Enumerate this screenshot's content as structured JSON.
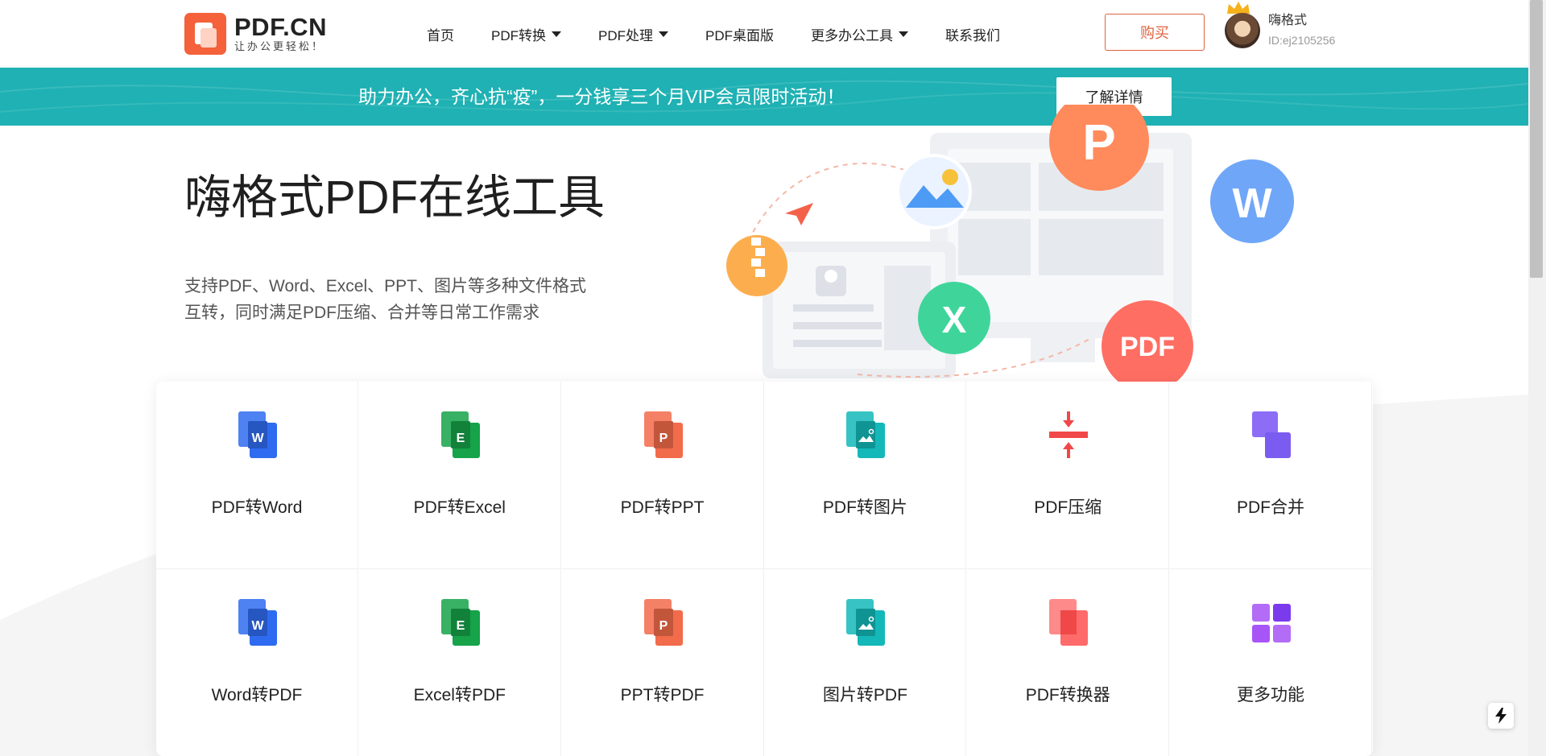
{
  "logo": {
    "title": "PDF.CN",
    "subtitle": "让办公更轻松！"
  },
  "nav": {
    "items": [
      {
        "label": "首页",
        "dropdown": false
      },
      {
        "label": "PDF转换",
        "dropdown": true
      },
      {
        "label": "PDF处理",
        "dropdown": true
      },
      {
        "label": "PDF桌面版",
        "dropdown": false
      },
      {
        "label": "更多办公工具",
        "dropdown": true
      },
      {
        "label": "联系我们",
        "dropdown": false
      }
    ]
  },
  "header": {
    "buy_label": "购买"
  },
  "user": {
    "name": "嗨格式",
    "id": "ID:ej2105256"
  },
  "banner": {
    "text": "助力办公，齐心抗“疫”，一分钱享三个月VIP会员限时活动！",
    "button": "了解详情",
    "color": "#1fb1b3"
  },
  "hero": {
    "title": "嗨格式PDF在线工具",
    "desc_line1": "支持PDF、Word、Excel、PPT、图片等多种文件格式",
    "desc_line2": "互转，同时满足PDF压缩、合并等日常工作需求"
  },
  "illustration": {
    "bubbles": [
      "P",
      "W",
      "X",
      "PDF"
    ]
  },
  "tools": [
    {
      "label": "PDF转Word",
      "icon": "word-doc-icon",
      "color": "#2f6bf0",
      "letter": "W"
    },
    {
      "label": "PDF转Excel",
      "icon": "excel-doc-icon",
      "color": "#16a34a",
      "letter": "E"
    },
    {
      "label": "PDF转PPT",
      "icon": "ppt-doc-icon",
      "color": "#f26b4a",
      "letter": "P"
    },
    {
      "label": "PDF转图片",
      "icon": "image-doc-icon",
      "color": "#14b8b8",
      "letter": ""
    },
    {
      "label": "PDF压缩",
      "icon": "compress-icon",
      "color": "#f04848",
      "letter": ""
    },
    {
      "label": "PDF合并",
      "icon": "merge-icon",
      "color": "#7b5cf0",
      "letter": ""
    },
    {
      "label": "Word转PDF",
      "icon": "word-doc-icon",
      "color": "#2f6bf0",
      "letter": "W"
    },
    {
      "label": "Excel转PDF",
      "icon": "excel-doc-icon",
      "color": "#16a34a",
      "letter": "E"
    },
    {
      "label": "PPT转PDF",
      "icon": "ppt-doc-icon",
      "color": "#f26b4a",
      "letter": "P"
    },
    {
      "label": "图片转PDF",
      "icon": "image-doc-icon",
      "color": "#14b8b8",
      "letter": ""
    },
    {
      "label": "PDF转换器",
      "icon": "converter-icon",
      "color": "#f04848",
      "letter": ""
    },
    {
      "label": "更多功能",
      "icon": "more-grid-icon",
      "color": "#8b5cf6",
      "letter": ""
    }
  ]
}
